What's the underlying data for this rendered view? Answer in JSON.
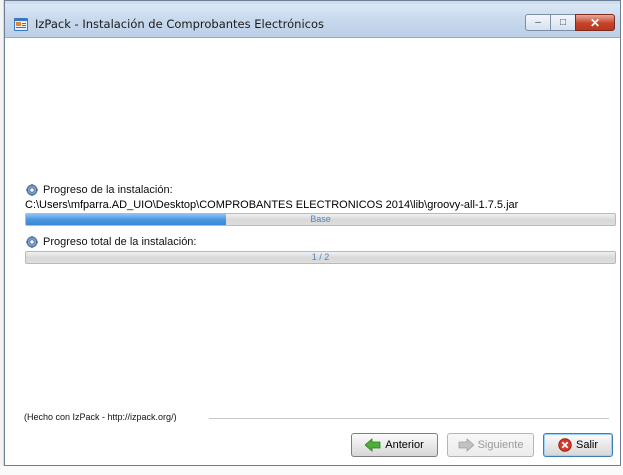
{
  "window": {
    "title": "IzPack - Instalación de Comprobantes Electrónicos",
    "buttons": {
      "minimize": "–",
      "maximize": "□",
      "close": "✕"
    }
  },
  "install": {
    "pack_label": "Progreso de la instalación:",
    "current_file": "C:\\Users\\mfparra.AD_UIO\\Desktop\\COMPROBANTES ELECTRONICOS 2014\\lib\\groovy-all-1.7.5.jar",
    "pack_progress": {
      "text": "Base",
      "fraction": 0.34
    },
    "overall_label": "Progreso total de la instalación:",
    "overall_progress": {
      "text": "1 / 2",
      "fraction": 0.0
    }
  },
  "footer": {
    "made_with": "(Hecho con IzPack - http://izpack.org/)"
  },
  "nav": {
    "back_label": "Anterior",
    "next_label": "Siguiente",
    "quit_label": "Salir"
  },
  "colors": {
    "progress_fill": "#4a97e0",
    "progress_text": "#4d86c9",
    "quit_accent": "#d23a2a"
  }
}
